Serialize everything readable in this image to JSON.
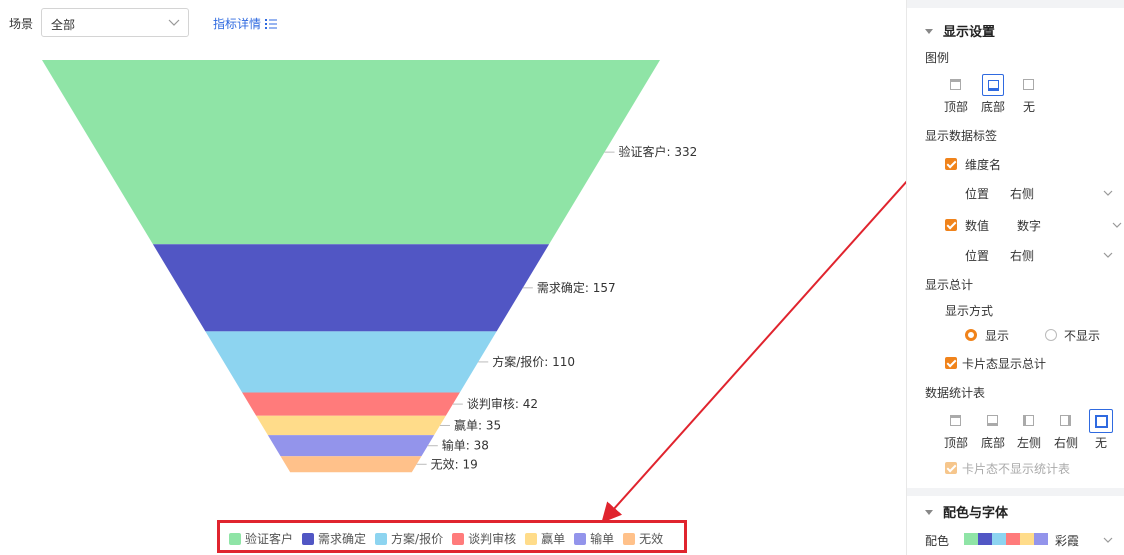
{
  "toolbar": {
    "scene_label": "场景",
    "scene_value": "全部",
    "detail_link": "指标详情"
  },
  "chart_data": {
    "type": "funnel",
    "categories": [
      "验证客户",
      "需求确定",
      "方案/报价",
      "谈判审核",
      "赢单",
      "输单",
      "无效"
    ],
    "values": [
      332,
      157,
      110,
      42,
      35,
      38,
      19
    ],
    "colors": [
      "#8fe4a6",
      "#5156c4",
      "#8dd4f0",
      "#ff7b7b",
      "#ffdc8a",
      "#9394eb",
      "#ffc18a"
    ],
    "data_labels": [
      "验证客户: 332",
      "需求确定: 157",
      "方案/报价: 110",
      "谈判审核: 42",
      "赢单: 35",
      "输单: 38",
      "无效: 19"
    ],
    "legend_position": "bottom"
  },
  "panel": {
    "display_section": "显示设置",
    "legend_label": "图例",
    "legend_options": [
      "顶部",
      "底部",
      "无"
    ],
    "legend_selected": "底部",
    "data_labels_label": "显示数据标签",
    "dimension_name": "维度名",
    "position_label": "位置",
    "dimension_position": "右侧",
    "value_label": "数值",
    "value_format": "数字",
    "value_position": "右侧",
    "total_label": "显示总计",
    "display_mode_label": "显示方式",
    "show_option": "显示",
    "hide_option": "不显示",
    "card_total": "卡片态显示总计",
    "stats_table_label": "数据统计表",
    "stats_options": [
      "顶部",
      "底部",
      "左侧",
      "右侧",
      "无"
    ],
    "stats_selected": "无",
    "card_no_stats": "卡片态不显示统计表",
    "color_font_section": "配色与字体",
    "palette_label": "配色",
    "palette_value": "彩霞",
    "palette_colors": [
      "#8fe4a6",
      "#5156c4",
      "#8dd4f0",
      "#ff7b7b",
      "#ffdc8a",
      "#9394eb"
    ]
  },
  "annotation": {
    "color": "#e0242e"
  }
}
